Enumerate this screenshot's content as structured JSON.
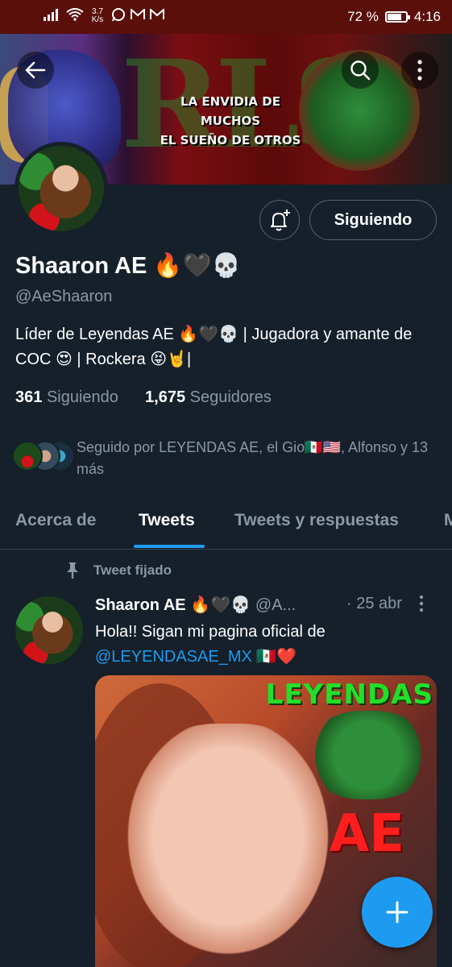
{
  "status_bar": {
    "net_speed": "3.7\nK/s",
    "battery_percent": "72 %",
    "battery_level": 0.72,
    "time": "4:16"
  },
  "banner": {
    "slogan_line1": "LA ENVIDIA DE MUCHOS",
    "slogan_line2": "EL SUEÑO DE OTROS",
    "big_text": "RLS"
  },
  "actions": {
    "following_label": "Siguiendo"
  },
  "profile": {
    "name": "Shaaron AE",
    "name_emoji": "🔥🖤💀",
    "handle": "@AeShaaron",
    "bio": "Líder de Leyendas AE 🔥🖤💀 | Jugadora y amante de COC 😍 | Rockera 😝🤘|",
    "following_count": "361",
    "following_label": "Siguiendo",
    "followers_count": "1,675",
    "followers_label": "Seguidores",
    "followed_by": "Seguido por LEYENDAS AE, el Gio🇲🇽🇺🇸, Alfonso y 13 más"
  },
  "tabs": [
    {
      "label": "Acerca de"
    },
    {
      "label": "Tweets"
    },
    {
      "label": "Tweets y respuestas"
    },
    {
      "label": "M"
    }
  ],
  "tweet": {
    "pinned_label": "Tweet fijado",
    "author_name": "Shaaron AE 🔥🖤💀",
    "author_handle": "@A...",
    "date": "· 25 abr",
    "text_before": "Hola!!  Sigan mi pagina oficial de",
    "mention": "@LEYENDASAE_MX",
    "text_after": " 🇲🇽❤️",
    "media_logo": "LEYENDAS",
    "media_ae": "AE"
  },
  "colors": {
    "background": "#15202b",
    "accent": "#1d9bf0",
    "muted": "#8b98a5",
    "status_bar": "#5b0f0b"
  }
}
